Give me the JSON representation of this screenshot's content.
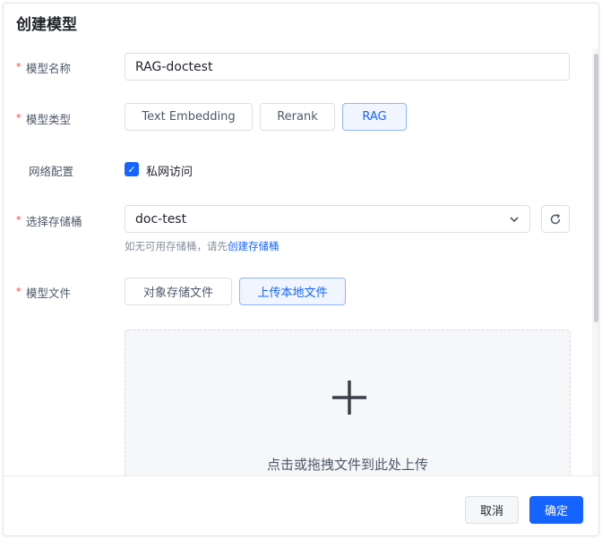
{
  "dialog": {
    "title": "创建模型"
  },
  "form": {
    "name": {
      "label": "模型名称",
      "value": "RAG-doctest",
      "required": true
    },
    "type": {
      "label": "模型类型",
      "required": true,
      "options": [
        "Text Embedding",
        "Rerank",
        "RAG"
      ],
      "selected": "RAG"
    },
    "network": {
      "label": "网络配置",
      "checkbox_label": "私网访问",
      "checked": true
    },
    "bucket": {
      "label": "选择存储桶",
      "required": true,
      "value": "doc-test",
      "hint_prefix": "如无可用存储桶，请先",
      "hint_link": "创建存储桶"
    },
    "file": {
      "label": "模型文件",
      "required": true,
      "options": [
        "对象存储文件",
        "上传本地文件"
      ],
      "selected": "上传本地文件",
      "upload_text": "点击或拖拽文件到此处上传"
    }
  },
  "footer": {
    "cancel": "取消",
    "confirm": "确定"
  },
  "colors": {
    "accent": "#1664ff",
    "required": "#f53f3f"
  }
}
